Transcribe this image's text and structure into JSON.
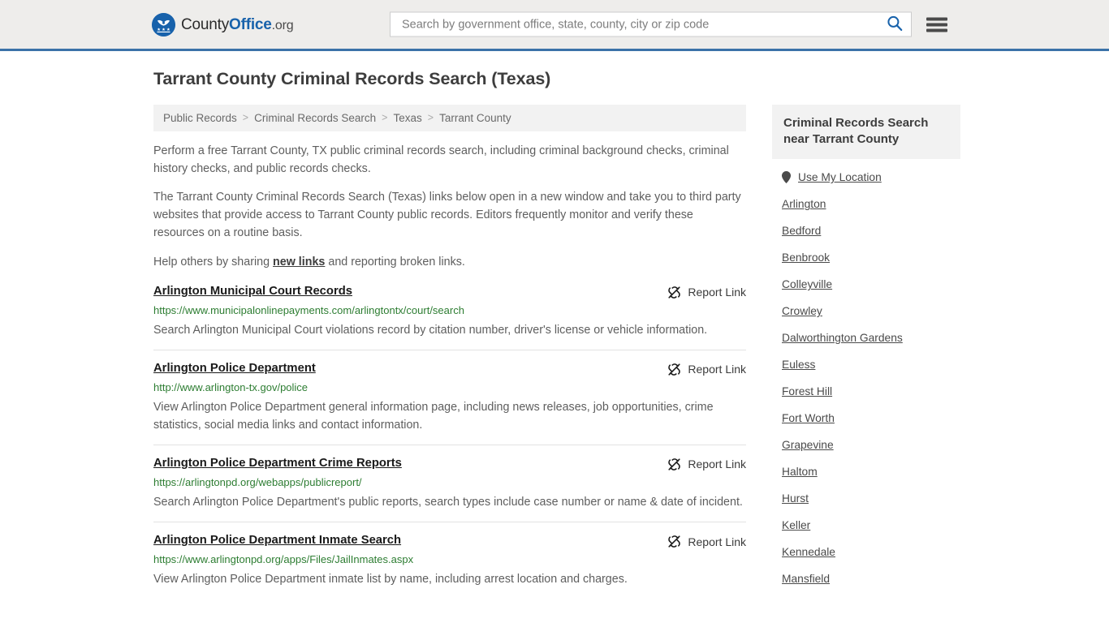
{
  "header": {
    "brand": {
      "part1": "County",
      "part2": "Office",
      "part3": ".org"
    },
    "search": {
      "placeholder": "Search by government office, state, county, city or zip code",
      "value": ""
    },
    "icons": {
      "search": "search-icon",
      "menu": "hamburger-menu-icon"
    },
    "accent_color": "#1862ab",
    "border_color": "#3b72a8"
  },
  "page_title": "Tarrant County Criminal Records Search (Texas)",
  "breadcrumb": {
    "items": [
      {
        "label": "Public Records",
        "current": false
      },
      {
        "label": "Criminal Records Search",
        "current": false
      },
      {
        "label": "Texas",
        "current": false
      },
      {
        "label": "Tarrant County",
        "current": true
      }
    ],
    "separator": ">"
  },
  "intro": {
    "p1": "Perform a free Tarrant County, TX public criminal records search, including criminal background checks, criminal history checks, and public records checks.",
    "p2": "The Tarrant County Criminal Records Search (Texas) links below open in a new window and take you to third party websites that provide access to Tarrant County public records. Editors frequently monitor and verify these resources on a routine basis.",
    "p3_before": "Help others by sharing ",
    "p3_link": "new links",
    "p3_after": " and reporting broken links."
  },
  "report_link_label": "Report Link",
  "report_link_icon": "broken-link-icon",
  "results": [
    {
      "title": "Arlington Municipal Court Records",
      "url": "https://www.municipalonlinepayments.com/arlingtontx/court/search",
      "description": "Search Arlington Municipal Court violations record by citation number, driver's license or vehicle information."
    },
    {
      "title": "Arlington Police Department",
      "url": "http://www.arlington-tx.gov/police",
      "description": "View Arlington Police Department general information page, including news releases, job opportunities, crime statistics, social media links and contact information."
    },
    {
      "title": "Arlington Police Department Crime Reports",
      "url": "https://arlingtonpd.org/webapps/publicreport/",
      "description": "Search Arlington Police Department's public reports, search types include case number or name & date of incident."
    },
    {
      "title": "Arlington Police Department Inmate Search",
      "url": "https://www.arlingtonpd.org/apps/Files/JailInmates.aspx",
      "description": "View Arlington Police Department inmate list by name, including arrest location and charges."
    }
  ],
  "sidebar": {
    "heading": "Criminal Records Search near Tarrant County",
    "use_my_location": "Use My Location",
    "location_icon": "map-pin-icon",
    "cities": [
      "Arlington",
      "Bedford",
      "Benbrook",
      "Colleyville",
      "Crowley",
      "Dalworthington Gardens",
      "Euless",
      "Forest Hill",
      "Fort Worth",
      "Grapevine",
      "Haltom",
      "Hurst",
      "Keller",
      "Kennedale",
      "Mansfield"
    ]
  }
}
